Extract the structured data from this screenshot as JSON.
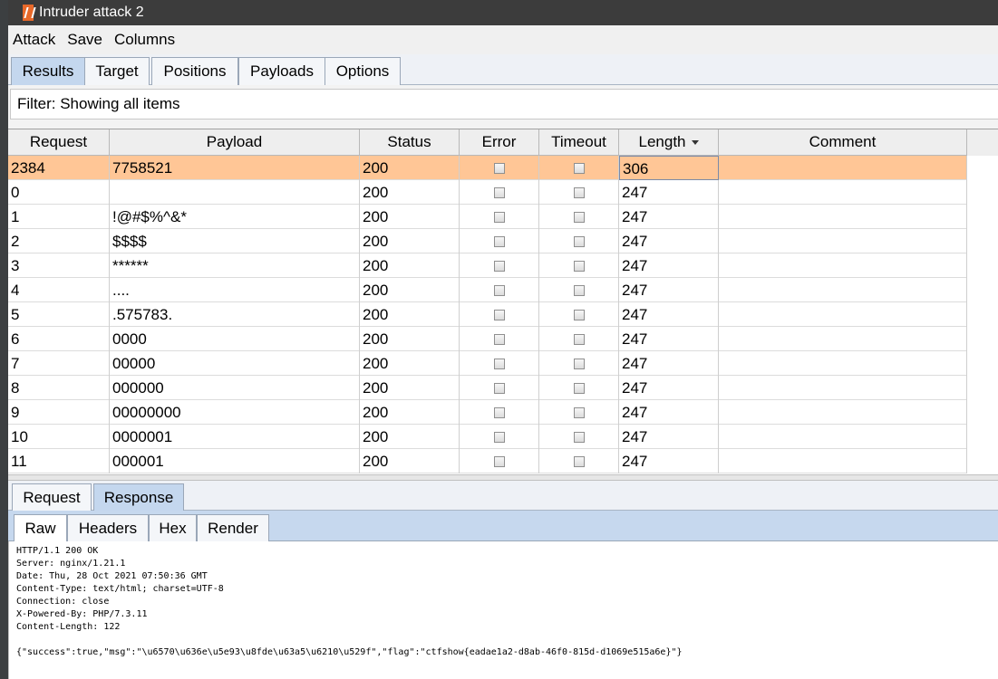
{
  "window": {
    "title": "Intruder attack 2"
  },
  "menu": [
    "Attack",
    "Save",
    "Columns"
  ],
  "tabs": [
    "Results",
    "Target",
    "Positions",
    "Payloads",
    "Options"
  ],
  "filter": {
    "text": "Filter: Showing all items"
  },
  "table": {
    "columns": [
      "Request",
      "Payload",
      "Status",
      "Error",
      "Timeout",
      "Length",
      "Comment"
    ],
    "sorted_column": "Length",
    "rows": [
      {
        "request": "2384",
        "payload": "7758521",
        "status": "200",
        "error": false,
        "timeout": false,
        "length": "306",
        "comment": ""
      },
      {
        "request": "0",
        "payload": "",
        "status": "200",
        "error": false,
        "timeout": false,
        "length": "247",
        "comment": ""
      },
      {
        "request": "1",
        "payload": "!@#$%^&*",
        "status": "200",
        "error": false,
        "timeout": false,
        "length": "247",
        "comment": ""
      },
      {
        "request": "2",
        "payload": "$$$$",
        "status": "200",
        "error": false,
        "timeout": false,
        "length": "247",
        "comment": ""
      },
      {
        "request": "3",
        "payload": "******",
        "status": "200",
        "error": false,
        "timeout": false,
        "length": "247",
        "comment": ""
      },
      {
        "request": "4",
        "payload": "....",
        "status": "200",
        "error": false,
        "timeout": false,
        "length": "247",
        "comment": ""
      },
      {
        "request": "5",
        "payload": ".575783.",
        "status": "200",
        "error": false,
        "timeout": false,
        "length": "247",
        "comment": ""
      },
      {
        "request": "6",
        "payload": "0000",
        "status": "200",
        "error": false,
        "timeout": false,
        "length": "247",
        "comment": ""
      },
      {
        "request": "7",
        "payload": "00000",
        "status": "200",
        "error": false,
        "timeout": false,
        "length": "247",
        "comment": ""
      },
      {
        "request": "8",
        "payload": "000000",
        "status": "200",
        "error": false,
        "timeout": false,
        "length": "247",
        "comment": ""
      },
      {
        "request": "9",
        "payload": "00000000",
        "status": "200",
        "error": false,
        "timeout": false,
        "length": "247",
        "comment": ""
      },
      {
        "request": "10",
        "payload": "0000001",
        "status": "200",
        "error": false,
        "timeout": false,
        "length": "247",
        "comment": ""
      },
      {
        "request": "11",
        "payload": "000001",
        "status": "200",
        "error": false,
        "timeout": false,
        "length": "247",
        "comment": ""
      }
    ]
  },
  "viewer_tabs": [
    "Request",
    "Response"
  ],
  "viewer_active": "Response",
  "sub_tabs": [
    "Raw",
    "Headers",
    "Hex",
    "Render"
  ],
  "sub_active": "Raw",
  "response": {
    "lines": [
      "HTTP/1.1 200 OK",
      "Server: nginx/1.21.1",
      "Date: Thu, 28 Oct 2021 07:50:36 GMT",
      "Content-Type: text/html; charset=UTF-8",
      "Connection: close",
      "X-Powered-By: PHP/7.3.11",
      "Content-Length: 122",
      "",
      "{\"success\":true,\"msg\":\"\\u6570\\u636e\\u5e93\\u8fde\\u63a5\\u6210\\u529f\",\"flag\":\"ctfshow{eadae1a2-d8ab-46f0-815d-d1069e515a6e}\"}"
    ]
  },
  "colors": {
    "selected_row": "#ffc696",
    "active_tab": "#c4d7ee",
    "titlebar": "#3c3c3c"
  }
}
